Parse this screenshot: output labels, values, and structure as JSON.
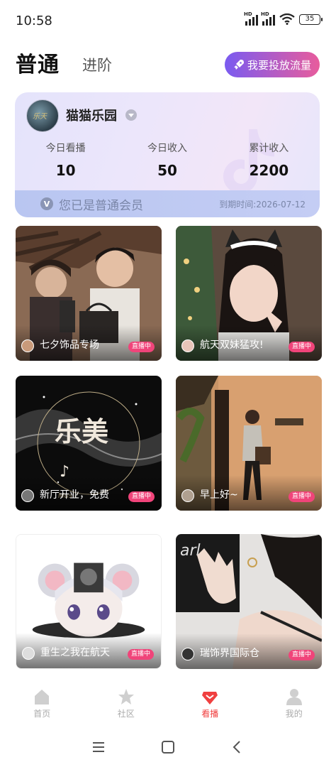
{
  "status_bar": {
    "time": "10:58",
    "battery": "35",
    "hd": "HD"
  },
  "header": {
    "tab_active": "普通",
    "tab_inactive": "进阶",
    "promote_button": "我要投放流量"
  },
  "member_card": {
    "name": "猫猫乐园",
    "stats": [
      {
        "label": "今日看播",
        "value": "10"
      },
      {
        "label": "今日收入",
        "value": "50"
      },
      {
        "label": "累计收入",
        "value": "2200"
      }
    ],
    "membership_text": "您已是普通会员",
    "expiry": "到期时间:2026-07-12"
  },
  "live_rooms": [
    {
      "title": "七夕饰品专场",
      "badge": "直播中"
    },
    {
      "title": "航天双妹猛攻!",
      "badge": "直播中"
    },
    {
      "title": "新厅开业，免费",
      "badge": "直播中",
      "art_text": "乐美"
    },
    {
      "title": "早上好~",
      "badge": "直播中"
    },
    {
      "title": "重生之我在航天",
      "badge": "直播中"
    },
    {
      "title": "瑞饰界国际仓",
      "badge": "直播中"
    }
  ],
  "bottom_nav": [
    {
      "label": "首页",
      "icon": "home-icon"
    },
    {
      "label": "社区",
      "icon": "star-icon"
    },
    {
      "label": "看播",
      "icon": "diamond-icon",
      "active": true
    },
    {
      "label": "我的",
      "icon": "person-icon"
    }
  ],
  "colors": {
    "accent": "#f04040",
    "live_badge": "#f0447a",
    "promote_gradient_start": "#7a5bf0",
    "promote_gradient_end": "#e85c9c"
  }
}
